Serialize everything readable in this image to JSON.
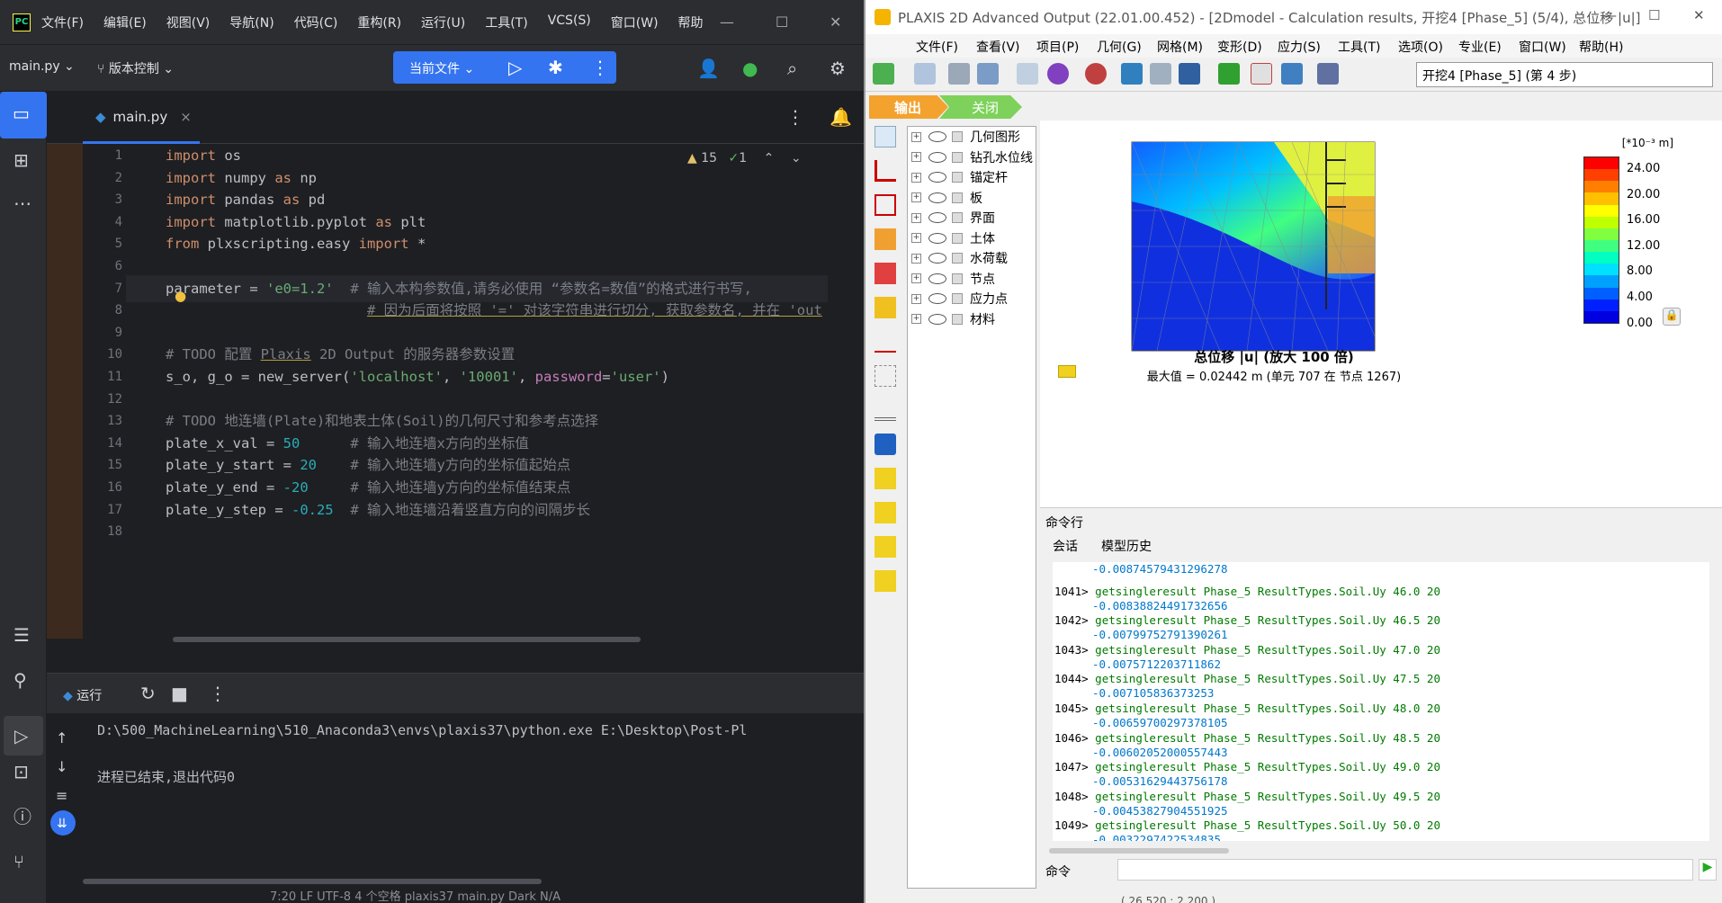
{
  "pycharm": {
    "logo": "PC",
    "menu": [
      "文件(F)",
      "编辑(E)",
      "视图(V)",
      "导航(N)",
      "代码(C)",
      "重构(R)",
      "运行(U)",
      "工具(T)",
      "VCS(S)",
      "窗口(W)",
      "帮助"
    ],
    "project": "main.py",
    "vcs": "版本控制",
    "run_config": "当前文件",
    "tab": "main.py",
    "inspections": {
      "warnings": "15",
      "ok": "1"
    },
    "code": [
      {
        "n": "1",
        "html": "<span class='kw'>import</span> os"
      },
      {
        "n": "2",
        "html": "<span class='kw'>import</span> numpy <span class='kw'>as</span> np"
      },
      {
        "n": "3",
        "html": "<span class='kw'>import</span> pandas <span class='kw'>as</span> pd"
      },
      {
        "n": "4",
        "html": "<span class='kw'>import</span> matplotlib.pyplot <span class='kw'>as</span> plt"
      },
      {
        "n": "5",
        "html": "<span class='kw'>from</span> plxscripting.easy <span class='kw'>import</span> *"
      },
      {
        "n": "6",
        "html": ""
      },
      {
        "n": "7",
        "html": "parameter = <span class='st'>'e0=1.2'</span>  <span class='cm'># 输入本构参数值,请务必使用 “参数名=数值”的格式进行书写,</span>"
      },
      {
        "n": "8",
        "html": "                        <span class='cm ul'># 因为后面将按照 '=' 对该字符串进行切分, 获取参数名, 并在 'out</span>"
      },
      {
        "n": "9",
        "html": ""
      },
      {
        "n": "10",
        "html": "<span class='cm'># TODO 配置 <span class='ul'>Plaxis</span> 2D Output 的服务器参数设置</span>"
      },
      {
        "n": "11",
        "html": "s_o, g_o = new_server(<span class='st'>'localhost'</span>, <span class='st'>'10001'</span>, <span class='pr'>password</span>=<span class='st'>'user'</span>)"
      },
      {
        "n": "12",
        "html": ""
      },
      {
        "n": "13",
        "html": "<span class='cm'># TODO 地连墙(Plate)和地表土体(Soil)的几何尺寸和参考点选择</span>"
      },
      {
        "n": "14",
        "html": "plate_x_val = <span class='nm'>50</span>      <span class='cm'># 输入地连墙x方向的坐标值</span>"
      },
      {
        "n": "15",
        "html": "plate_y_start = <span class='nm'>20</span>    <span class='cm'># 输入地连墙y方向的坐标值起始点</span>"
      },
      {
        "n": "16",
        "html": "plate_y_end = <span class='nm'>-20</span>     <span class='cm'># 输入地连墙y方向的坐标值结束点</span>"
      },
      {
        "n": "17",
        "html": "plate_y_step = <span class='nm'>-0.25</span>  <span class='cm'># 输入地连墙沿着竖直方向的间隔步长</span>"
      },
      {
        "n": "18",
        "html": ""
      }
    ],
    "run_label": "运行",
    "console": [
      "D:\\500_MachineLearning\\510_Anaconda3\\envs\\plaxis37\\python.exe E:\\Desktop\\Post-Pl",
      "",
      "进程已结束,退出代码0"
    ],
    "status": "7:20   LF   UTF-8   4 个空格   plaxis37        main.py      Dark        N/A"
  },
  "plaxis": {
    "title": "PLAXIS 2D Advanced Output (22.01.00.452) - [2Dmodel - Calculation results, 开挖4 [Phase_5] (5/4), 总位移 |u|]",
    "menu": [
      "文件(F)",
      "查看(V)",
      "项目(P)",
      "几何(G)",
      "网格(M)",
      "变形(D)",
      "应力(S)",
      "工具(T)",
      "选项(O)",
      "专业(E)",
      "窗口(W)",
      "帮助(H)"
    ],
    "step": "开挖4 [Phase_5] (第 4 步)",
    "tab_output": "输出",
    "tab_close": "关闭",
    "tree": [
      "几何图形",
      "钻孔水位线",
      "锚定杆",
      "板",
      "界面",
      "土体",
      "水荷载",
      "节点",
      "应力点",
      "材料"
    ],
    "legend_unit": "[*10⁻³ m]",
    "legend_ticks": [
      "24.00",
      "20.00",
      "16.00",
      "12.00",
      "8.00",
      "4.00",
      "0.00"
    ],
    "legend_colors": [
      "#ff0000",
      "#ff4000",
      "#ff8000",
      "#ffc000",
      "#ffff00",
      "#c0ff00",
      "#80ff40",
      "#40ff80",
      "#00ffc0",
      "#00e0ff",
      "#00a0ff",
      "#0060ff",
      "#0020ff",
      "#0000e0"
    ],
    "plot_title": "总位移 |u| (放大 100 倍)",
    "plot_sub": "最大值 = 0.02442 m (单元 707 在 节点 1267)",
    "cmd_title": "命令行",
    "cmd_tabs": [
      "会话",
      "模型历史"
    ],
    "cmd_label": "命令",
    "log": [
      {
        "num": "",
        "cmd": "",
        "val": "-0.00874579431296278"
      },
      {
        "num": "1041>",
        "cmd": "getsingleresult Phase_5 ResultTypes.Soil.Uy 46.0 20",
        "val": "-0.00838824491732656"
      },
      {
        "num": "1042>",
        "cmd": "getsingleresult Phase_5 ResultTypes.Soil.Uy 46.5 20",
        "val": "-0.00799752791390261"
      },
      {
        "num": "1043>",
        "cmd": "getsingleresult Phase_5 ResultTypes.Soil.Uy 47.0 20",
        "val": "-0.0075712203711862"
      },
      {
        "num": "1044>",
        "cmd": "getsingleresult Phase_5 ResultTypes.Soil.Uy 47.5 20",
        "val": "-0.007105836373253"
      },
      {
        "num": "1045>",
        "cmd": "getsingleresult Phase_5 ResultTypes.Soil.Uy 48.0 20",
        "val": "-0.00659700297378105"
      },
      {
        "num": "1046>",
        "cmd": "getsingleresult Phase_5 ResultTypes.Soil.Uy 48.5 20",
        "val": "-0.00602052000557443"
      },
      {
        "num": "1047>",
        "cmd": "getsingleresult Phase_5 ResultTypes.Soil.Uy 49.0 20",
        "val": "-0.00531629443756178"
      },
      {
        "num": "1048>",
        "cmd": "getsingleresult Phase_5 ResultTypes.Soil.Uy 49.5 20",
        "val": "-0.00453827904551925"
      },
      {
        "num": "1049>",
        "cmd": "getsingleresult Phase_5 ResultTypes.Soil.Uy 50.0 20",
        "val": "-0.0032297422534835"
      }
    ],
    "coords": "( 26.520 ; 2.200 )"
  }
}
